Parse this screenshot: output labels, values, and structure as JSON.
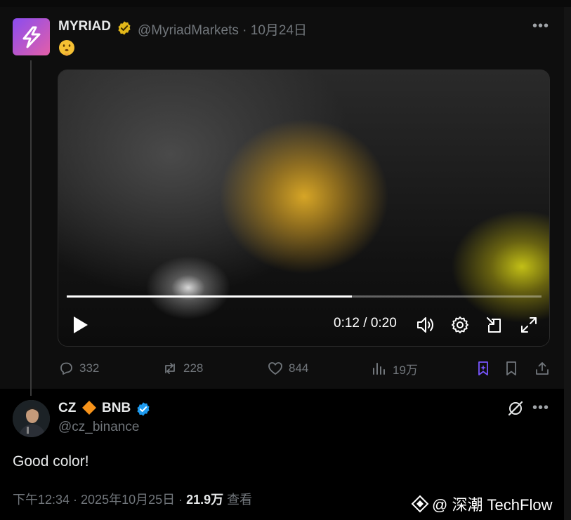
{
  "quoted_tweet": {
    "author_name": "MYRIAD",
    "handle_and_date": "@MyriadMarkets · 10月24日",
    "emoji": "🫢",
    "video": {
      "progress": 0.6,
      "time_label": "0:12 / 0:20"
    },
    "actions": {
      "replies": "332",
      "retweets": "228",
      "likes": "844",
      "views": "19万"
    }
  },
  "reply_tweet": {
    "author_name_left": "CZ",
    "author_name_right": "BNB",
    "handle": "@cz_binance",
    "text": "Good color!",
    "meta_time": "下午12:34 · 2025年10月25日 · ",
    "meta_views_count": "21.9万",
    "meta_views_label": " 查看"
  },
  "watermark": {
    "text": "@ 深潮 TechFlow"
  },
  "colors": {
    "background": "#000000",
    "gold_verified": "#e2b719",
    "blue_verified": "#1d9bf0",
    "muted_text": "#71767b",
    "bookmark_accent": "#7856ff"
  }
}
